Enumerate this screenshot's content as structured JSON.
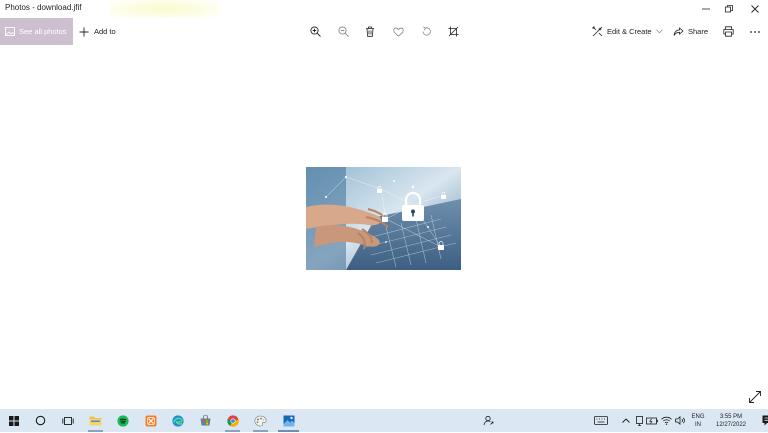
{
  "window": {
    "title": "Photos - download.jfif"
  },
  "toolbar": {
    "see_all_label": "See all photos",
    "add_to_label": "Add to",
    "edit_create_label": "Edit & Create",
    "share_label": "Share"
  },
  "image": {
    "description_icon": "padlock-icon"
  },
  "taskbar": {
    "language_line1": "ENG",
    "language_line2": "IN",
    "time": "3:55 PM",
    "date": "12/27/2022",
    "notification_count": "5"
  },
  "colors": {
    "accent": "#cdbfd0",
    "taskbar_bg": "#dbe8f3"
  }
}
